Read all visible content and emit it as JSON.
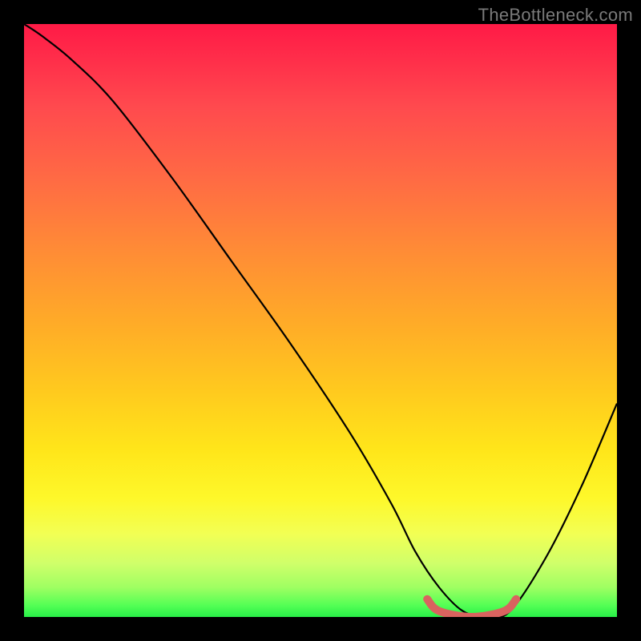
{
  "watermark": "TheBottleneck.com",
  "colors": {
    "background": "#000000",
    "curve_stroke": "#000000",
    "minimum_highlight": "#d9635f"
  },
  "chart_data": {
    "type": "line",
    "title": "",
    "xlabel": "",
    "ylabel": "",
    "xlim": [
      0,
      100
    ],
    "ylim": [
      0,
      100
    ],
    "series": [
      {
        "name": "curve",
        "x": [
          0,
          3,
          8,
          15,
          25,
          35,
          45,
          55,
          62,
          66,
          70,
          74,
          78,
          82,
          88,
          94,
          100
        ],
        "y": [
          100,
          98,
          94,
          87,
          74,
          60,
          46,
          31,
          19,
          11,
          5,
          1,
          0,
          1,
          10,
          22,
          36
        ]
      }
    ],
    "minimum_region": {
      "x_start": 68,
      "x_end": 83,
      "y": 0
    },
    "grid": false,
    "legend": false
  }
}
